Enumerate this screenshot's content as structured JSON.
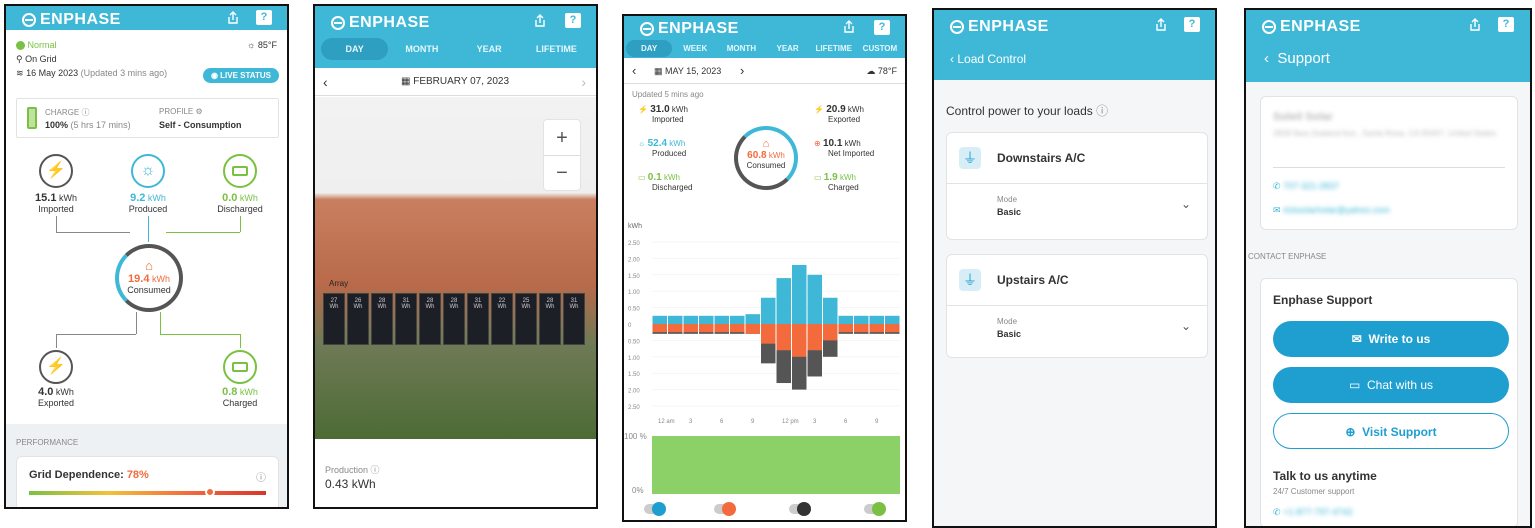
{
  "brand": "ENPHASE",
  "help_glyph": "?",
  "panel1": {
    "status": "Normal",
    "temperature": "85°F",
    "grid": "On Grid",
    "date": "16 May 2023",
    "updated": "(Updated 3 mins ago)",
    "live_status": "LIVE STATUS",
    "charge_label": "CHARGE",
    "charge_value": "100%",
    "charge_time": "(5 hrs 17 mins)",
    "profile_label": "PROFILE",
    "profile_value": "Self - Consumption",
    "imported_value": "15.1",
    "imported_label": "Imported",
    "produced_value": "9.2",
    "produced_label": "Produced",
    "discharged_value": "0.0",
    "discharged_label": "Discharged",
    "consumed_value": "19.4",
    "consumed_label": "Consumed",
    "exported_value": "4.0",
    "exported_label": "Exported",
    "charged_value": "0.8",
    "charged_label": "Charged",
    "unit": "kWh",
    "performance_label": "PERFORMANCE",
    "grid_dependence_label": "Grid Dependence:",
    "grid_dependence_value": "78%"
  },
  "panel2": {
    "tabs": [
      "DAY",
      "MONTH",
      "YEAR",
      "LIFETIME"
    ],
    "date": "FEBRUARY 07, 2023",
    "zoom_in": "+",
    "zoom_out": "−",
    "array_label": "Array",
    "panel_values": [
      "27",
      "26",
      "28",
      "31",
      "28",
      "28",
      "31",
      "22",
      "25",
      "28",
      "31"
    ],
    "panel_unit": "Wh",
    "production_label": "Production",
    "production_value": "0.43 kWh"
  },
  "panel3": {
    "tabs": [
      "DAY",
      "WEEK",
      "MONTH",
      "YEAR",
      "LIFETIME",
      "CUSTOM"
    ],
    "date": "MAY 15, 2023",
    "temp": "78°F",
    "updated": "Updated 5 mins ago",
    "imported_value": "31.0",
    "imported_label": "Imported",
    "exported_value": "20.9",
    "exported_label": "Exported",
    "produced_value": "52.4",
    "produced_label": "Produced",
    "consumed_value": "60.8",
    "consumed_label": "Consumed",
    "net_imported_value": "10.1",
    "net_imported_label": "Net Imported",
    "discharged_value": "0.1",
    "discharged_label": "Discharged",
    "charged_value": "1.9",
    "charged_label": "Charged",
    "unit": "kWh",
    "pct_top": "100 %",
    "pct_bottom": "0%"
  },
  "chart_data": {
    "type": "bar",
    "ylabel": "kWh",
    "ylim": [
      -2.5,
      2.5
    ],
    "yticks": [
      "2.50",
      "2.00",
      "1.50",
      "1.00",
      "0.50",
      "0",
      "0.50",
      "1.00",
      "1.50",
      "2.00",
      "2.50"
    ],
    "xticks": [
      "12 am",
      "3",
      "6",
      "9",
      "12 pm",
      "3",
      "6",
      "9"
    ],
    "series": [
      {
        "values": [
          0.25,
          0.25,
          0.25,
          0.25,
          0.25,
          0.25,
          0.3,
          0.8,
          1.4,
          1.8,
          1.5,
          0.8,
          0.25,
          0.25,
          0.25,
          0.25
        ]
      },
      {
        "values": [
          -0.25,
          -0.25,
          -0.25,
          -0.25,
          -0.25,
          -0.25,
          -0.3,
          -0.6,
          -0.8,
          -1.0,
          -0.8,
          -0.5,
          -0.25,
          -0.25,
          -0.25,
          -0.25
        ]
      },
      {
        "values": [
          -0.3,
          -0.3,
          -0.3,
          -0.3,
          -0.3,
          -0.3,
          -0.3,
          -1.2,
          -1.8,
          -2.0,
          -1.6,
          -1.0,
          -0.3,
          -0.3,
          -0.3,
          -0.3
        ]
      }
    ]
  },
  "panel4": {
    "back_label": "Load Control",
    "heading": "Control power to your loads",
    "loads": [
      {
        "name": "Downstairs A/C",
        "mode_label": "Mode",
        "mode_value": "Basic"
      },
      {
        "name": "Upstairs A/C",
        "mode_label": "Mode",
        "mode_value": "Basic"
      }
    ]
  },
  "panel5": {
    "back_label": "Support",
    "installer_name": "Soleil Solar",
    "installer_address": "3928 New Zealand Ave., Santa Rosa, CA 95407, United States",
    "installer_phone": "707-321-2837",
    "installer_email": "ricksolarholar@yahoo.com",
    "contact_label": "CONTACT ENPHASE",
    "support_heading": "Enphase Support",
    "write_label": "Write to us",
    "chat_label": "Chat with us",
    "visit_label": "Visit Support",
    "talk_label": "Talk to us anytime",
    "talk_sub": "24/7 Customer support",
    "support_phone": "+1-877-797-4743"
  },
  "colors": {
    "accent": "#3fb8d8",
    "orange": "#f36b3d",
    "green": "#7ac143",
    "dark": "#555555"
  }
}
